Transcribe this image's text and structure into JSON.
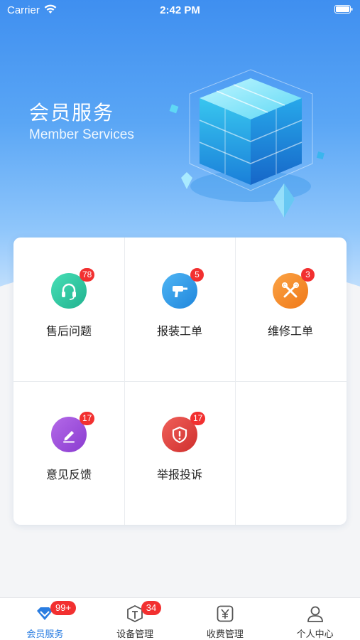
{
  "status_bar": {
    "carrier": "Carrier",
    "time": "2:42 PM"
  },
  "hero": {
    "title": "会员服务",
    "subtitle": "Member Services"
  },
  "menu": [
    {
      "label": "售后问题",
      "badge": "78",
      "icon": "headset-icon",
      "color": "#2fc6a0"
    },
    {
      "label": "报装工单",
      "badge": "5",
      "icon": "drill-icon",
      "color": "#2c9be8"
    },
    {
      "label": "维修工单",
      "badge": "3",
      "icon": "tools-icon",
      "color": "#f58a22"
    },
    {
      "label": "意见反馈",
      "badge": "17",
      "icon": "edit-icon",
      "color": "#9c4fd8"
    },
    {
      "label": "举报投诉",
      "badge": "17",
      "icon": "alert-shield-icon",
      "color": "#e0403e"
    }
  ],
  "tabs": [
    {
      "label": "会员服务",
      "badge": "99+",
      "icon": "member-icon",
      "active": true
    },
    {
      "label": "设备管理",
      "badge": "34",
      "icon": "box-icon",
      "active": false
    },
    {
      "label": "收费管理",
      "badge": "",
      "icon": "yuan-icon",
      "active": false
    },
    {
      "label": "个人中心",
      "badge": "",
      "icon": "user-icon",
      "active": false
    }
  ],
  "colors": {
    "accent": "#2a7de1",
    "badge": "#f23030"
  }
}
